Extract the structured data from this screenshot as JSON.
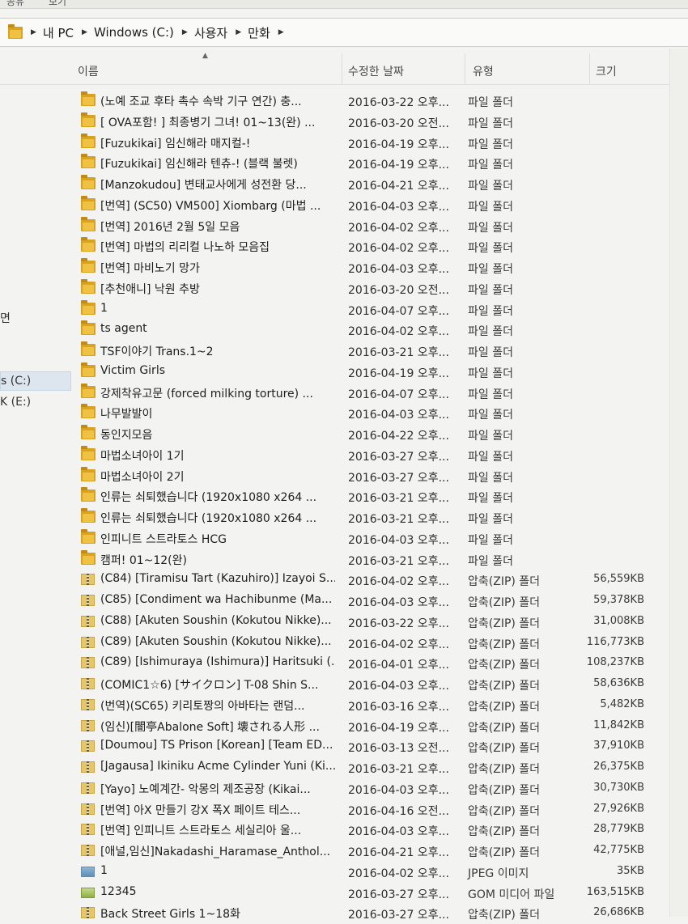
{
  "breadcrumb": [
    "내 PC",
    "Windows (C:)",
    "사용자",
    "만화"
  ],
  "columns": {
    "name": "이름",
    "date": "수정한 날짜",
    "type": "유형",
    "size": "크기"
  },
  "nav_items": [
    {
      "label": "면",
      "selected": false
    },
    {
      "label": "s (C:)",
      "selected": true
    },
    {
      "label": "K (E:)",
      "selected": false
    }
  ],
  "files": [
    {
      "icon": "folder",
      "name": "(노예 조교 후타 촉수 속박 기구 연간) 충...",
      "date": "2016-03-22 오후...",
      "type": "파일 폴더",
      "size": ""
    },
    {
      "icon": "folder",
      "name": "[ OVA포함! ] 최종병기 그녀! 01~13(완) ...",
      "date": "2016-03-20 오전...",
      "type": "파일 폴더",
      "size": ""
    },
    {
      "icon": "folder",
      "name": "[Fuzukikai] 임신해라 매지컬-!",
      "date": "2016-04-19 오후...",
      "type": "파일 폴더",
      "size": ""
    },
    {
      "icon": "folder",
      "name": "[Fuzukikai] 임신해라 텐츄-! (블랙 불렛)",
      "date": "2016-04-19 오후...",
      "type": "파일 폴더",
      "size": ""
    },
    {
      "icon": "folder",
      "name": "[Manzokudou] 변태교사에게 성전환 당...",
      "date": "2016-04-21 오후...",
      "type": "파일 폴더",
      "size": ""
    },
    {
      "icon": "folder",
      "name": "[번역] (SC50) VM500] Xiombarg (마법 ...",
      "date": "2016-04-03 오후...",
      "type": "파일 폴더",
      "size": ""
    },
    {
      "icon": "folder",
      "name": "[번역] 2016년 2월 5일 모음",
      "date": "2016-04-02 오후...",
      "type": "파일 폴더",
      "size": ""
    },
    {
      "icon": "folder",
      "name": "[번역] 마법의 리리컬 나노하 모음집",
      "date": "2016-04-02 오후...",
      "type": "파일 폴더",
      "size": ""
    },
    {
      "icon": "folder",
      "name": "[번역] 마비노기 망가",
      "date": "2016-04-03 오후...",
      "type": "파일 폴더",
      "size": ""
    },
    {
      "icon": "folder",
      "name": "[추천애니] 낙원 추방",
      "date": "2016-03-20 오전...",
      "type": "파일 폴더",
      "size": ""
    },
    {
      "icon": "folder",
      "name": "1",
      "date": "2016-04-07 오후...",
      "type": "파일 폴더",
      "size": ""
    },
    {
      "icon": "folder",
      "name": "ts agent",
      "date": "2016-04-02 오후...",
      "type": "파일 폴더",
      "size": ""
    },
    {
      "icon": "folder",
      "name": "TSF이야기 Trans.1~2",
      "date": "2016-03-21 오후...",
      "type": "파일 폴더",
      "size": ""
    },
    {
      "icon": "folder",
      "name": "Victim Girls",
      "date": "2016-04-19 오후...",
      "type": "파일 폴더",
      "size": ""
    },
    {
      "icon": "folder",
      "name": "강제착유고문 (forced milking torture) ...",
      "date": "2016-04-07 오후...",
      "type": "파일 폴더",
      "size": ""
    },
    {
      "icon": "folder",
      "name": "나무발발이",
      "date": "2016-04-03 오후...",
      "type": "파일 폴더",
      "size": ""
    },
    {
      "icon": "folder",
      "name": "동인지모음",
      "date": "2016-04-22 오후...",
      "type": "파일 폴더",
      "size": ""
    },
    {
      "icon": "folder",
      "name": "마법소녀아이 1기",
      "date": "2016-03-27 오후...",
      "type": "파일 폴더",
      "size": ""
    },
    {
      "icon": "folder",
      "name": "마법소녀아이 2기",
      "date": "2016-03-27 오후...",
      "type": "파일 폴더",
      "size": ""
    },
    {
      "icon": "folder",
      "name": "인류는 쇠퇴했습니다 (1920x1080 x264 ...",
      "date": "2016-03-21 오후...",
      "type": "파일 폴더",
      "size": ""
    },
    {
      "icon": "folder",
      "name": "인류는 쇠퇴했습니다 (1920x1080 x264 ...",
      "date": "2016-03-21 오후...",
      "type": "파일 폴더",
      "size": ""
    },
    {
      "icon": "folder",
      "name": "인피니트 스트라토스 HCG",
      "date": "2016-04-03 오후...",
      "type": "파일 폴더",
      "size": ""
    },
    {
      "icon": "folder",
      "name": "캠퍼! 01~12(완)",
      "date": "2016-03-21 오후...",
      "type": "파일 폴더",
      "size": ""
    },
    {
      "icon": "zip",
      "name": "(C84) [Tiramisu Tart (Kazuhiro)] Izayoi S...",
      "date": "2016-04-02 오후...",
      "type": "압축(ZIP) 폴더",
      "size": "56,559KB"
    },
    {
      "icon": "zip",
      "name": "(C85) [Condiment wa Hachibunme (Ma...",
      "date": "2016-04-03 오후...",
      "type": "압축(ZIP) 폴더",
      "size": "59,378KB"
    },
    {
      "icon": "zip",
      "name": "(C88) [Akuten Soushin (Kokutou Nikke)...",
      "date": "2016-03-22 오후...",
      "type": "압축(ZIP) 폴더",
      "size": "31,008KB"
    },
    {
      "icon": "zip",
      "name": "(C89) [Akuten Soushin (Kokutou Nikke)...",
      "date": "2016-04-02 오후...",
      "type": "압축(ZIP) 폴더",
      "size": "116,773KB"
    },
    {
      "icon": "zip",
      "name": "(C89) [Ishimuraya (Ishimura)] Haritsuki (...",
      "date": "2016-04-01 오후...",
      "type": "압축(ZIP) 폴더",
      "size": "108,237KB"
    },
    {
      "icon": "zip",
      "name": "(COMIC1☆6) [サイクロン] T-08 Shin S...",
      "date": "2016-04-03 오후...",
      "type": "압축(ZIP) 폴더",
      "size": "58,636KB"
    },
    {
      "icon": "zip",
      "name": "(번역)(SC65) 키리토짱의 아바타는 랜덤...",
      "date": "2016-03-16 오후...",
      "type": "압축(ZIP) 폴더",
      "size": "5,482KB"
    },
    {
      "icon": "zip",
      "name": "(임신)[闇亭Abalone Soft] 壊される人形 ...",
      "date": "2016-04-19 오후...",
      "type": "압축(ZIP) 폴더",
      "size": "11,842KB"
    },
    {
      "icon": "zip",
      "name": "[Doumou] TS Prison [Korean] [Team ED...",
      "date": "2016-03-13 오전...",
      "type": "압축(ZIP) 폴더",
      "size": "37,910KB"
    },
    {
      "icon": "zip",
      "name": "[Jagausa] Ikiniku Acme Cylinder Yuni (Ki...",
      "date": "2016-03-21 오후...",
      "type": "압축(ZIP) 폴더",
      "size": "26,375KB"
    },
    {
      "icon": "zip",
      "name": "[Yayo] 노예계간- 악몽의 제조공장 (Kikai...",
      "date": "2016-04-03 오후...",
      "type": "압축(ZIP) 폴더",
      "size": "30,730KB"
    },
    {
      "icon": "zip",
      "name": "[번역] 아X 만들기 강X 폭X 페이트 테스...",
      "date": "2016-04-16 오전...",
      "type": "압축(ZIP) 폴더",
      "size": "27,926KB"
    },
    {
      "icon": "zip",
      "name": "[번역] 인피니트 스트라토스 세실리아 울...",
      "date": "2016-04-03 오후...",
      "type": "압축(ZIP) 폴더",
      "size": "28,779KB"
    },
    {
      "icon": "zip",
      "name": "[애널,임신]Nakadashi_Haramase_Anthol...",
      "date": "2016-04-21 오후...",
      "type": "압축(ZIP) 폴더",
      "size": "42,775KB"
    },
    {
      "icon": "jpeg",
      "name": "1",
      "date": "2016-04-02 오후...",
      "type": "JPEG 이미지",
      "size": "35KB"
    },
    {
      "icon": "media",
      "name": "12345",
      "date": "2016-03-27 오후...",
      "type": "GOM 미디어 파일",
      "size": "163,515KB"
    },
    {
      "icon": "zip",
      "name": "Back Street Girls 1~18화",
      "date": "2016-03-27 오후...",
      "type": "압축(ZIP) 폴더",
      "size": "26,686KB"
    }
  ]
}
